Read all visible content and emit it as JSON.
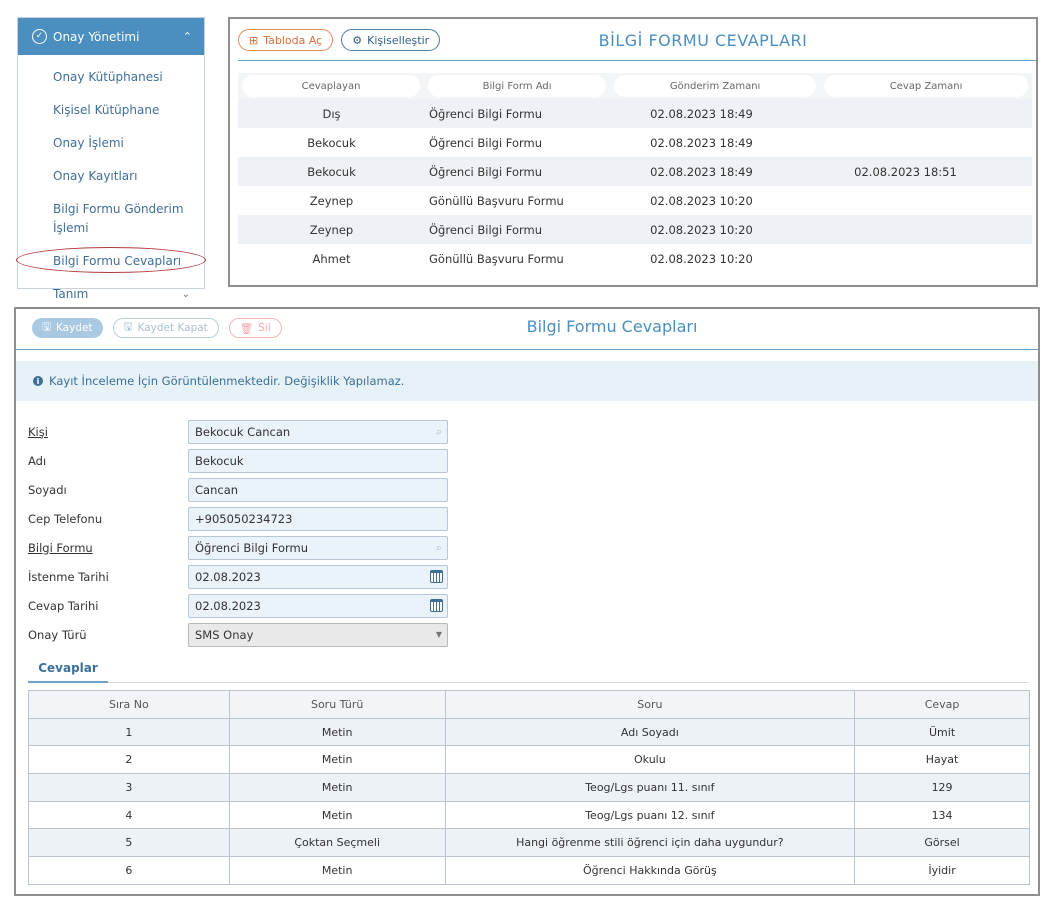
{
  "sidebar": {
    "header": {
      "title": "Onay Yönetimi",
      "icon": "check-circle-icon",
      "caret": "^"
    },
    "items": [
      {
        "label": "Onay Kütüphanesi"
      },
      {
        "label": "Kişisel Kütüphane"
      },
      {
        "label": "Onay İşlemi"
      },
      {
        "label": "Onay Kayıtları"
      },
      {
        "label": "Bilgi Formu Gönderim İşlemi"
      },
      {
        "label": "Bilgi Formu Cevapları"
      },
      {
        "label": "Tanım"
      }
    ]
  },
  "list_panel": {
    "title": "BİLGİ FORMU CEVAPLARI",
    "buttons": {
      "open_table": "Tabloda Aç",
      "customize": "Kişiselleştir"
    },
    "columns": [
      "Cevaplayan",
      "Bilgi Form Adı",
      "Gönderim Zamanı",
      "Cevap Zamanı"
    ],
    "rows": [
      [
        "Dış",
        "Öğrenci Bilgi Formu",
        "02.08.2023 18:49",
        ""
      ],
      [
        "Bekocuk",
        "Öğrenci Bilgi Formu",
        "02.08.2023 18:49",
        ""
      ],
      [
        "Bekocuk",
        "Öğrenci Bilgi Formu",
        "02.08.2023 18:49",
        "02.08.2023 18:51"
      ],
      [
        "Zeynep",
        "Gönüllü Başvuru Formu",
        "02.08.2023 10:20",
        ""
      ],
      [
        "Zeynep",
        "Öğrenci Bilgi Formu",
        "02.08.2023 10:20",
        ""
      ],
      [
        "Ahmet",
        "Gönüllü Başvuru Formu",
        "02.08.2023 10:20",
        ""
      ]
    ]
  },
  "form_panel": {
    "title": "Bilgi Formu Cevapları",
    "buttons": {
      "save": "Kaydet",
      "save_close": "Kaydet Kapat",
      "delete": "Sil"
    },
    "alert": "Kayıt İnceleme İçin Görüntülenmektedir. Değişiklik Yapılamaz.",
    "fields": {
      "kisi": {
        "label": "Kişi",
        "value": "Bekocuk Cancan"
      },
      "adi": {
        "label": "Adı",
        "value": "Bekocuk"
      },
      "soyadi": {
        "label": "Soyadı",
        "value": "Cancan"
      },
      "cep": {
        "label": "Cep Telefonu",
        "value": "+905050234723"
      },
      "bilgi_formu": {
        "label": "Bilgi Formu",
        "value": "Öğrenci Bilgi Formu"
      },
      "istenme": {
        "label": "İstenme Tarihi",
        "value": "02.08.2023"
      },
      "cevap_tarihi": {
        "label": "Cevap Tarihi",
        "value": "02.08.2023"
      },
      "onay_turu": {
        "label": "Onay Türü",
        "value": "SMS Onay"
      }
    },
    "tab": "Cevaplar",
    "answers": {
      "columns": [
        "Sıra No",
        "Soru Türü",
        "Soru",
        "Cevap"
      ],
      "rows": [
        [
          "1",
          "Metin",
          "Adı Soyadı",
          "Ümit"
        ],
        [
          "2",
          "Metin",
          "Okulu",
          "Hayat"
        ],
        [
          "3",
          "Metin",
          "Teog/Lgs puanı 11. sınıf",
          "129"
        ],
        [
          "4",
          "Metin",
          "Teog/Lgs puanı 12. sınıf",
          "134"
        ],
        [
          "5",
          "Çoktan Seçmeli",
          "Hangi öğrenme stili öğrenci için daha uygundur?",
          "Görsel"
        ],
        [
          "6",
          "Metin",
          "Öğrenci Hakkında Görüş",
          "İyidir"
        ]
      ]
    }
  }
}
